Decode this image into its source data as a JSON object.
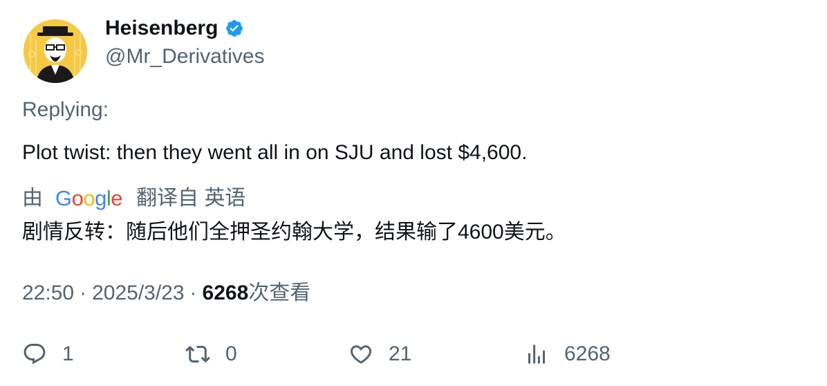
{
  "author": {
    "display_name": "Heisenberg",
    "handle": "@Mr_Derivatives",
    "verified": true,
    "avatar_icon": "heisenberg-avatar",
    "verified_color": "#1d9bf0"
  },
  "replying_label": "Replying:",
  "tweet_text": "Plot twist: then they went all in on SJU and lost $4,600.",
  "translation": {
    "prefix": "由",
    "provider": "Google",
    "translated_from": "翻译自 英语",
    "text": "剧情反转：随后他们全押圣约翰大学，结果输了4600美元。"
  },
  "meta": {
    "time": "22:50",
    "separator": "·",
    "date": "2025/3/23",
    "views_count": "6268",
    "views_label": "次查看"
  },
  "actions": {
    "reply": {
      "icon": "reply-icon",
      "count": "1"
    },
    "retweet": {
      "icon": "retweet-icon",
      "count": "0"
    },
    "like": {
      "icon": "heart-icon",
      "count": "21"
    },
    "views": {
      "icon": "views-chart-icon",
      "count": "6268"
    }
  },
  "colors": {
    "text_primary": "#0f1419",
    "text_secondary": "#536471",
    "verified_blue": "#1d9bf0",
    "google_blue": "#4285f4",
    "google_red": "#ea4335",
    "google_yellow": "#fbbc05",
    "google_green": "#34a853"
  }
}
